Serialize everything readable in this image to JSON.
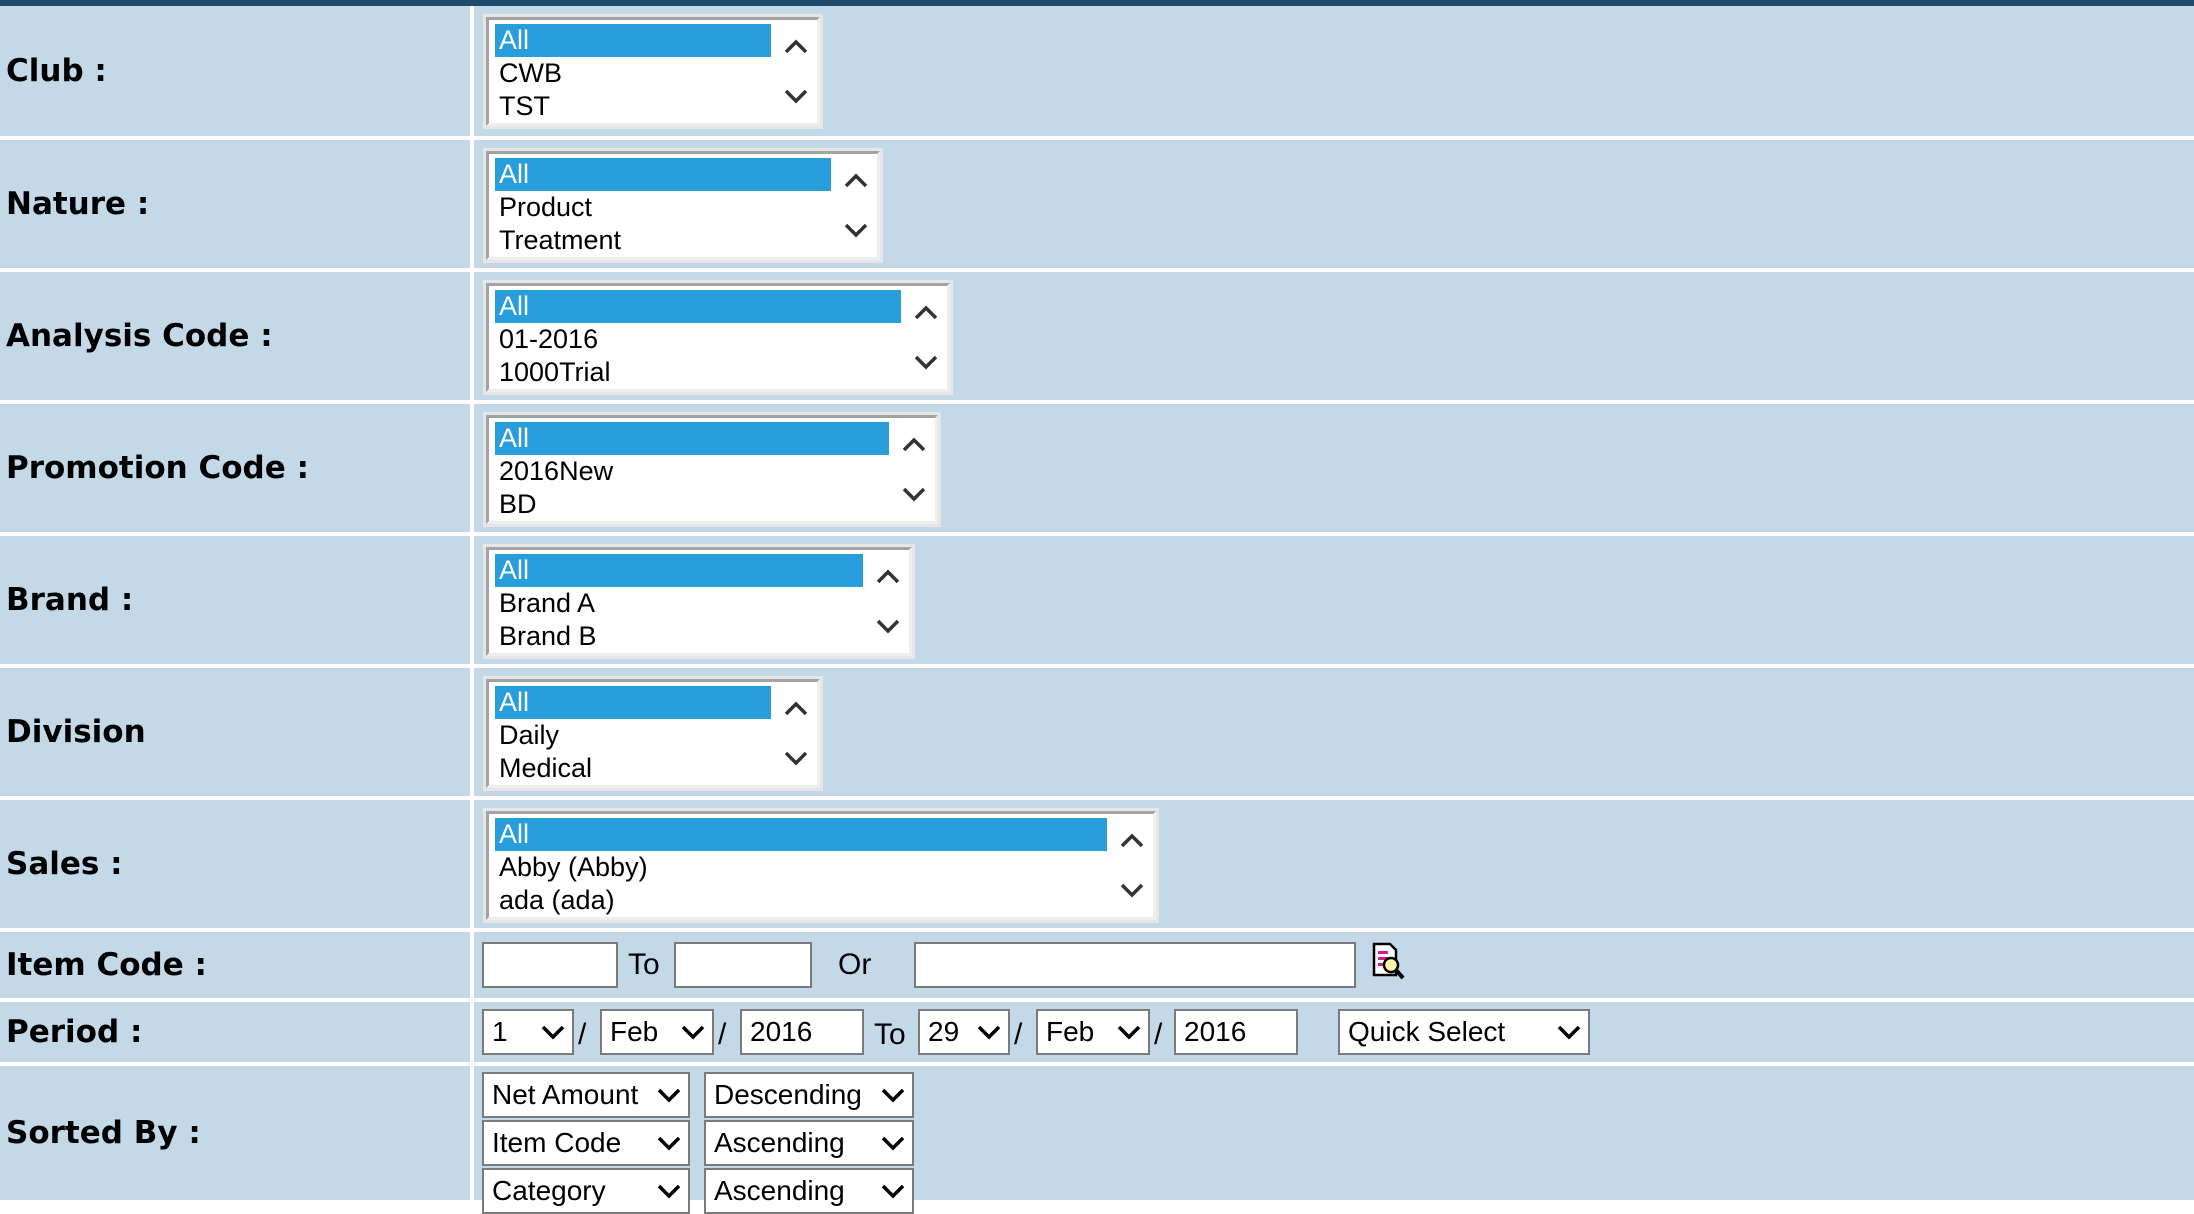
{
  "filters": {
    "club": {
      "label": "Club :",
      "options": [
        "All",
        "CWB",
        "TST"
      ],
      "selected": "All"
    },
    "nature": {
      "label": "Nature :",
      "options": [
        "All",
        "Product",
        "Treatment"
      ],
      "selected": "All"
    },
    "analysis_code": {
      "label": "Analysis Code :",
      "options": [
        "All",
        "01-2016",
        "1000Trial"
      ],
      "selected": "All"
    },
    "promotion_code": {
      "label": "Promotion Code :",
      "options": [
        "All",
        "2016New",
        "BD"
      ],
      "selected": "All"
    },
    "brand": {
      "label": "Brand :",
      "options": [
        "All",
        "Brand A",
        "Brand B"
      ],
      "selected": "All"
    },
    "division": {
      "label": "Division",
      "options": [
        "All",
        "Daily",
        "Medical"
      ],
      "selected": "All"
    },
    "sales": {
      "label": "Sales :",
      "options": [
        "All",
        "Abby (Abby)",
        "ada (ada)"
      ],
      "selected": "All"
    }
  },
  "item_code": {
    "label": "Item Code :",
    "from_value": "",
    "to_word": "To",
    "to_value": "",
    "or_word": "Or",
    "search_value": "",
    "lookup_icon": "lookup-icon"
  },
  "period": {
    "label": "Period :",
    "from_day": "1",
    "from_month": "Feb",
    "from_year": "2016",
    "to_word": "To",
    "to_day": "29",
    "to_month": "Feb",
    "to_year": "2016",
    "separator": "/",
    "quick_select": "Quick Select"
  },
  "sorted_by": {
    "label": "Sorted By :",
    "rows": [
      {
        "field": "Net Amount",
        "order": "Descending"
      },
      {
        "field": "Item Code",
        "order": "Ascending"
      },
      {
        "field": "Category",
        "order": "Ascending"
      }
    ]
  },
  "colors": {
    "row_bg": "#c3d9e7",
    "selected_bg": "#279ddb",
    "header_bar": "#1f4a6a"
  }
}
